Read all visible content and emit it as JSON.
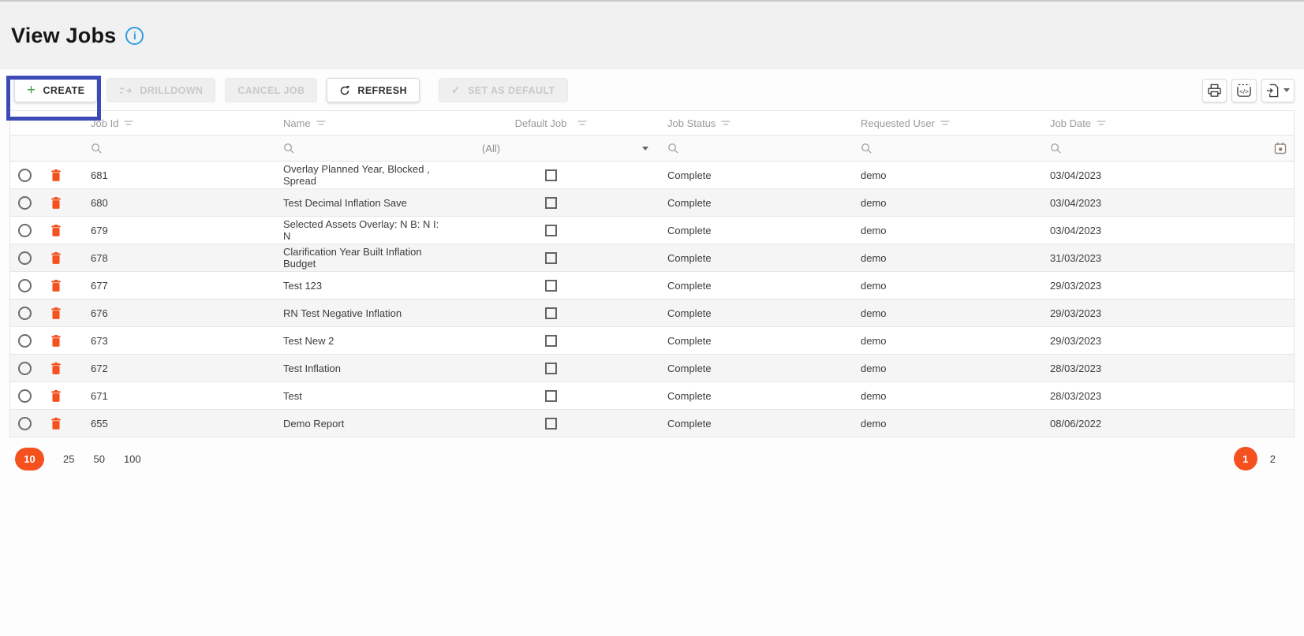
{
  "page": {
    "title": "View Jobs",
    "info_glyph": "i"
  },
  "toolbar": {
    "create": "CREATE",
    "drilldown": "DRILLDOWN",
    "cancel_job": "CANCEL JOB",
    "refresh": "REFRESH",
    "set_as_default": "SET AS DEFAULT"
  },
  "icons": {
    "plus": "+",
    "check": "✓"
  },
  "table": {
    "columns": [
      "Job Id",
      "Name",
      "Default Job",
      "Job Status",
      "Requested User",
      "Job Date"
    ],
    "filter_row": {
      "default_job": "(All)"
    },
    "rows": [
      {
        "job_id": "681",
        "name": "Overlay Planned Year, Blocked , Spread",
        "job_status": "Complete",
        "requested_user": "demo",
        "job_date": "03/04/2023"
      },
      {
        "job_id": "680",
        "name": "Test Decimal Inflation Save",
        "job_status": "Complete",
        "requested_user": "demo",
        "job_date": "03/04/2023"
      },
      {
        "job_id": "679",
        "name": "Selected Assets Overlay: N B: N I: N",
        "job_status": "Complete",
        "requested_user": "demo",
        "job_date": "03/04/2023"
      },
      {
        "job_id": "678",
        "name": "Clarification Year Built Inflation Budget",
        "job_status": "Complete",
        "requested_user": "demo",
        "job_date": "31/03/2023"
      },
      {
        "job_id": "677",
        "name": "Test 123",
        "job_status": "Complete",
        "requested_user": "demo",
        "job_date": "29/03/2023"
      },
      {
        "job_id": "676",
        "name": "RN Test Negative Inflation",
        "job_status": "Complete",
        "requested_user": "demo",
        "job_date": "29/03/2023"
      },
      {
        "job_id": "673",
        "name": "Test New 2",
        "job_status": "Complete",
        "requested_user": "demo",
        "job_date": "29/03/2023"
      },
      {
        "job_id": "672",
        "name": "Test Inflation",
        "job_status": "Complete",
        "requested_user": "demo",
        "job_date": "28/03/2023"
      },
      {
        "job_id": "671",
        "name": "Test",
        "job_status": "Complete",
        "requested_user": "demo",
        "job_date": "28/03/2023"
      },
      {
        "job_id": "655",
        "name": "Demo Report",
        "job_status": "Complete",
        "requested_user": "demo",
        "job_date": "08/06/2022"
      }
    ]
  },
  "pager": {
    "page_sizes": [
      "10",
      "25",
      "50",
      "100"
    ],
    "selected_page_size": "10",
    "pages": [
      "1",
      "2"
    ],
    "selected_page": "1"
  },
  "colors": {
    "accent_orange": "#f4511e",
    "highlight_box_blue": "#3c4ab8",
    "info_blue": "#2f9fe0",
    "create_plus_green": "#43a047"
  }
}
